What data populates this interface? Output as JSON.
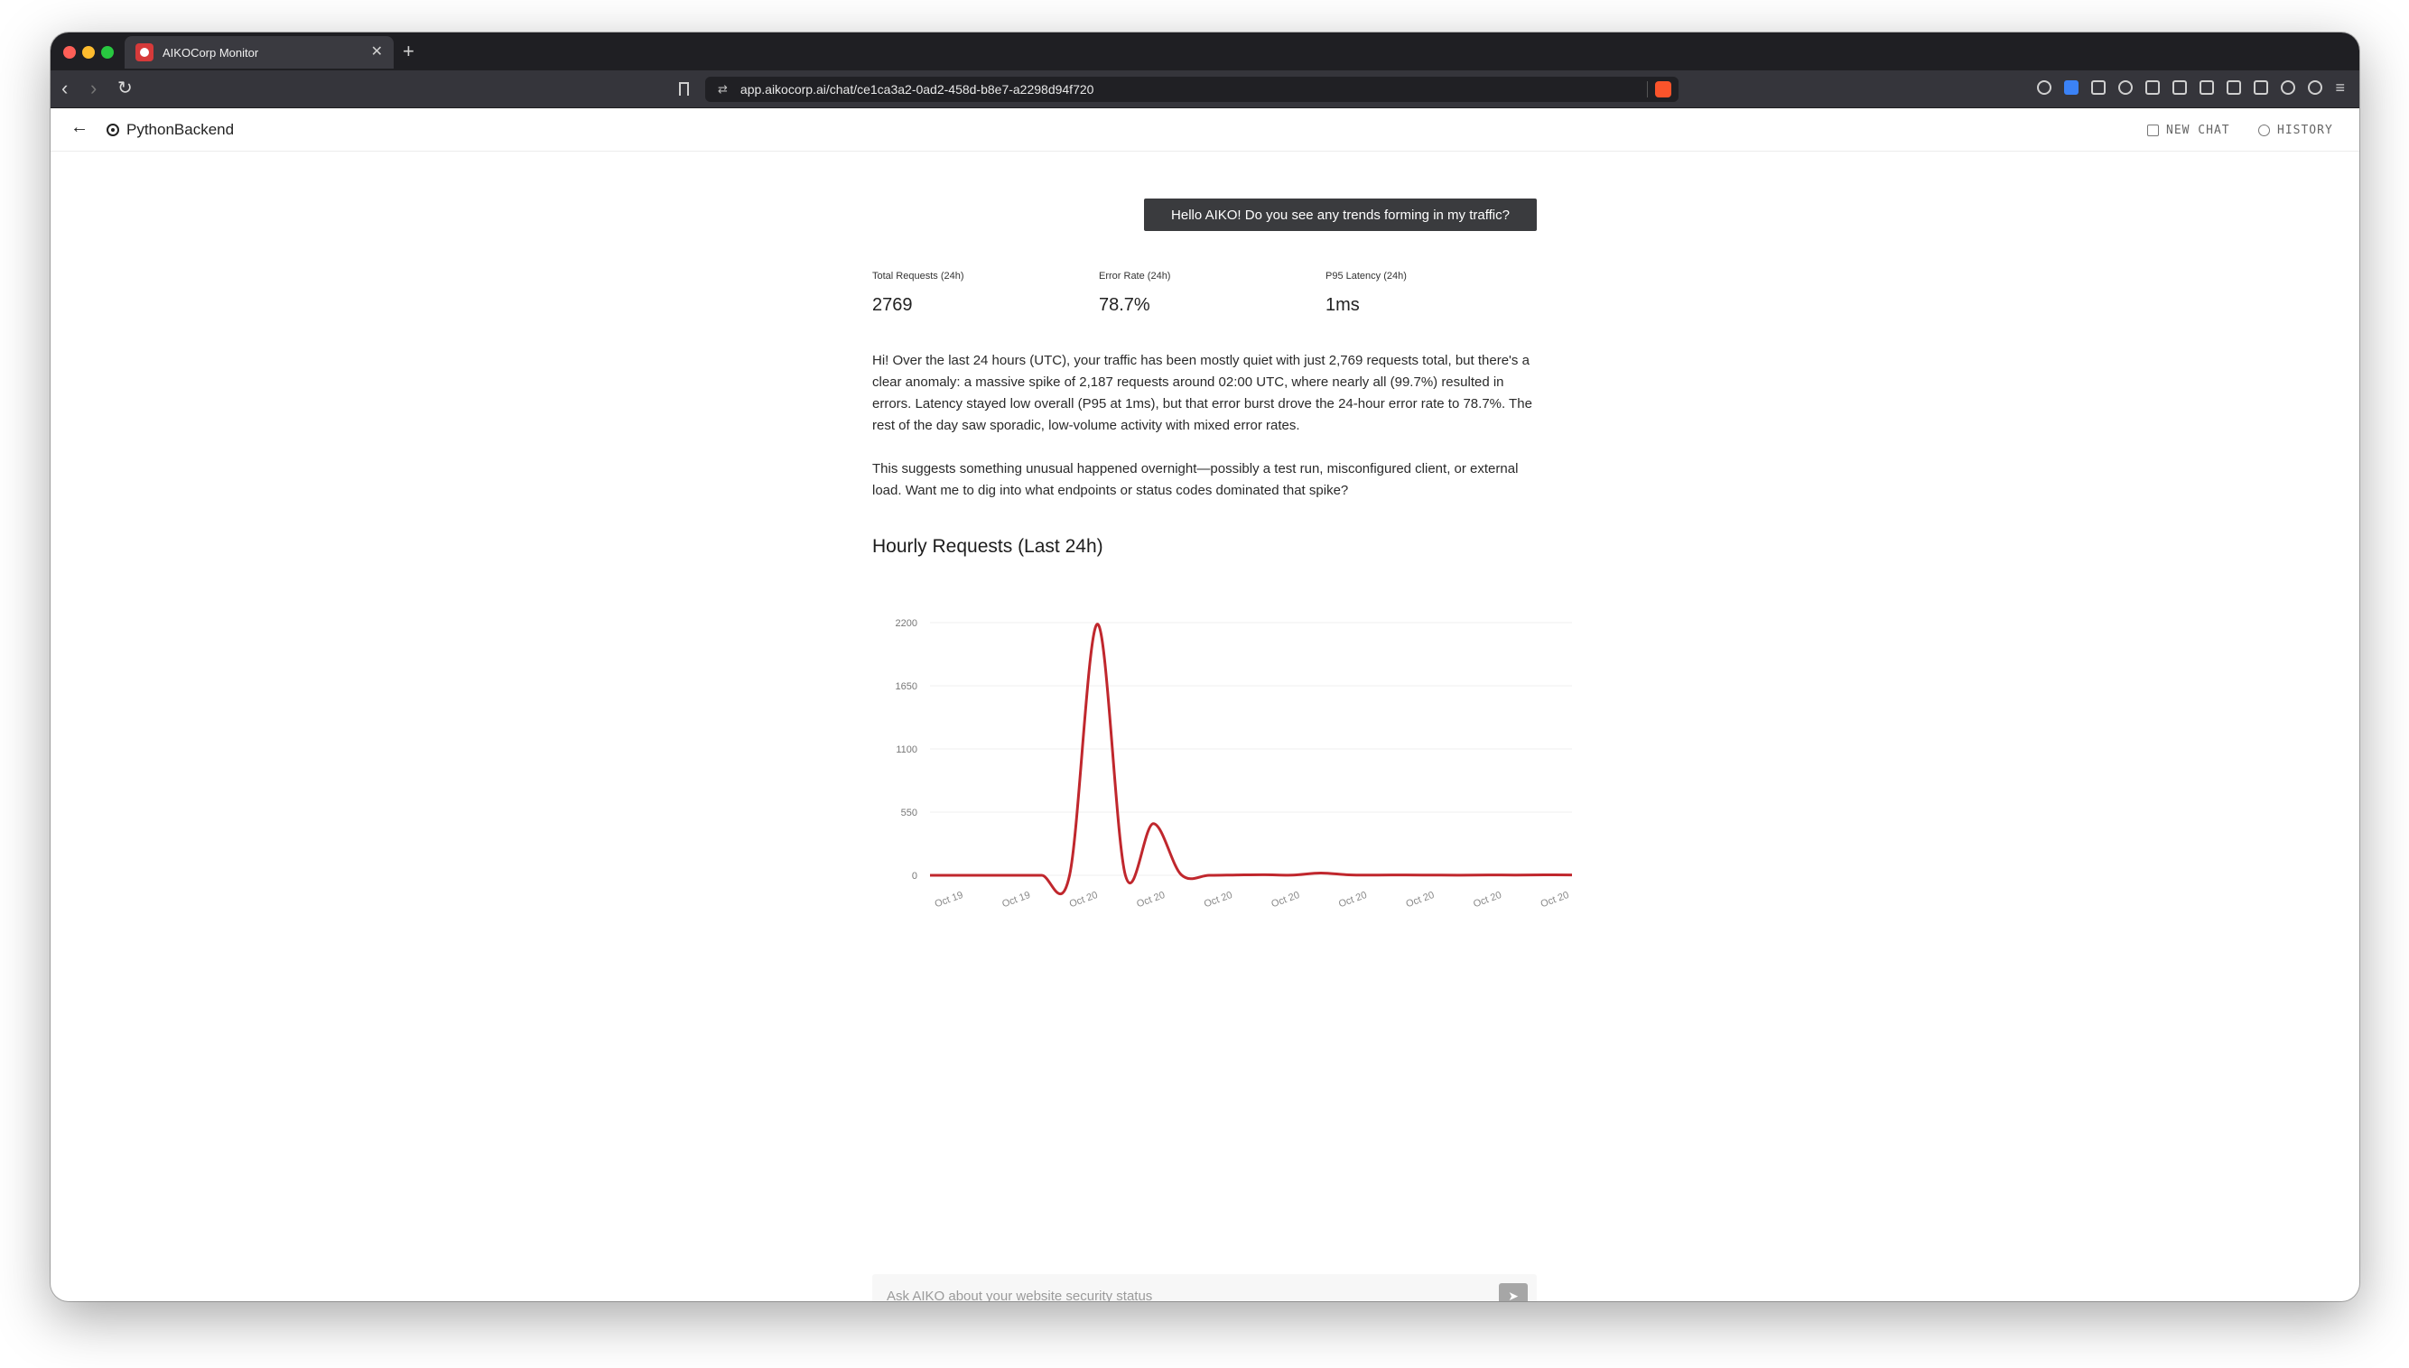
{
  "browser": {
    "tab_title": "AIKOCorp Monitor",
    "url": "app.aikocorp.ai/chat/ce1ca3a2-0ad2-458d-b8e7-a2298d94f720",
    "new_tab_glyph": "+",
    "close_glyph": "✕"
  },
  "app": {
    "title": "PythonBackend",
    "new_chat_label": "NEW CHAT",
    "history_label": "HISTORY"
  },
  "chat": {
    "user_message": "Hello AIKO! Do you see any trends forming in my traffic?",
    "stats": [
      {
        "label": "Total Requests (24h)",
        "value": "2769"
      },
      {
        "label": "Error Rate (24h)",
        "value": "78.7%"
      },
      {
        "label": "P95 Latency (24h)",
        "value": "1ms"
      }
    ],
    "reply_p1": "Hi! Over the last 24 hours (UTC), your traffic has been mostly quiet with just 2,769 requests total, but there's a clear anomaly: a massive spike of 2,187 requests around 02:00 UTC, where nearly all (99.7%) resulted in errors. Latency stayed low overall (P95 at 1ms), but that error burst drove the 24-hour error rate to 78.7%. The rest of the day saw sporadic, low-volume activity with mixed error rates.",
    "reply_p2": "This suggests something unusual happened overnight—possibly a test run, misconfigured client, or external load. Want me to dig into what endpoints or status codes dominated that spike?",
    "input_placeholder": "Ask AIKO about your website security status"
  },
  "chart_data": {
    "type": "line",
    "title": "Hourly Requests (Last 24h)",
    "xlabel": "",
    "ylabel": "",
    "x_tick_labels": [
      "Oct 19",
      "Oct 19",
      "Oct 20",
      "Oct 20",
      "Oct 20",
      "Oct 20",
      "Oct 20",
      "Oct 20",
      "Oct 20",
      "Oct 20"
    ],
    "y_ticks": [
      0,
      550,
      1100,
      1650,
      2200
    ],
    "ylim": [
      0,
      2200
    ],
    "grid": true,
    "color": "#c0272d",
    "series": [
      {
        "values": [
          0,
          0,
          0,
          0,
          0,
          0,
          2187,
          0,
          450,
          5,
          0,
          3,
          5,
          2,
          20,
          4,
          2,
          3,
          2,
          1,
          3,
          2,
          4,
          3
        ]
      }
    ]
  }
}
